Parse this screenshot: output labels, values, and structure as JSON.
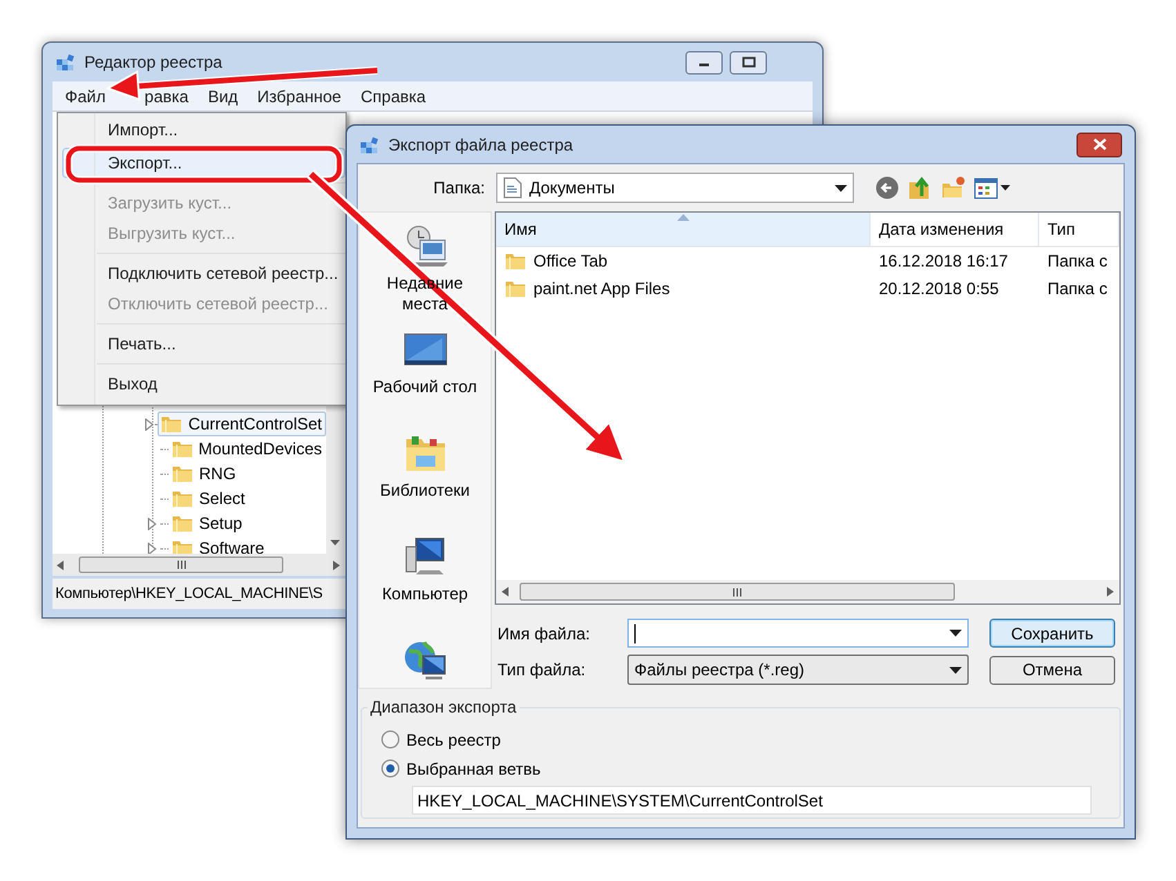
{
  "registry_window": {
    "title": "Редактор реестра",
    "menu": [
      "Файл",
      "равка",
      "Вид",
      "Избранное",
      "Справка"
    ],
    "file_menu": [
      {
        "kind": "item",
        "label": "Импорт...",
        "disabled": false,
        "selected": false
      },
      {
        "kind": "item",
        "label": "Экспорт...",
        "disabled": false,
        "selected": true
      },
      {
        "kind": "separator"
      },
      {
        "kind": "item",
        "label": "Загрузить куст...",
        "disabled": true,
        "selected": false
      },
      {
        "kind": "item",
        "label": "Выгрузить куст...",
        "disabled": true,
        "selected": false
      },
      {
        "kind": "separator"
      },
      {
        "kind": "item",
        "label": "Подключить сетевой реестр...",
        "disabled": false,
        "selected": false
      },
      {
        "kind": "item",
        "label": "Отключить сетевой реестр...",
        "disabled": true,
        "selected": false
      },
      {
        "kind": "separator"
      },
      {
        "kind": "item",
        "label": "Печать...",
        "disabled": false,
        "selected": false
      },
      {
        "kind": "separator"
      },
      {
        "kind": "item",
        "label": "Выход",
        "disabled": false,
        "selected": false
      }
    ],
    "tree": [
      {
        "label": "CurrentControlSet",
        "has_children": true,
        "selected": true
      },
      {
        "label": "MountedDevices",
        "has_children": false,
        "selected": false
      },
      {
        "label": "RNG",
        "has_children": false,
        "selected": false
      },
      {
        "label": "Select",
        "has_children": false,
        "selected": false
      },
      {
        "label": "Setup",
        "has_children": true,
        "selected": false
      },
      {
        "label": "Software",
        "has_children": true,
        "selected": false
      }
    ],
    "status_bar": "Компьютер\\HKEY_LOCAL_MACHINE\\S"
  },
  "export_dialog": {
    "title": "Экспорт файла реестра",
    "folder_label": "Папка:",
    "folder": "Документы",
    "places": [
      {
        "kind": "recent",
        "label": "Недавние места"
      },
      {
        "kind": "desktop",
        "label": "Рабочий стол"
      },
      {
        "kind": "libraries",
        "label": "Библиотеки"
      },
      {
        "kind": "computer",
        "label": "Компьютер"
      },
      {
        "kind": "network"
      }
    ],
    "columns": [
      {
        "label": "Имя",
        "sorted": true
      },
      {
        "label": "Дата изменения",
        "sorted": false
      },
      {
        "label": "Тип",
        "sorted": false
      }
    ],
    "rows": [
      [
        "Office Tab",
        "16.12.2018 16:17",
        "Папка с"
      ],
      [
        "paint.net App Files",
        "20.12.2018 0:55",
        "Папка с"
      ]
    ],
    "file_name_label": "Имя файла:",
    "file_type_label": "Тип файла:",
    "file_type": "Файлы реестра (*.reg)",
    "buttons": [
      {
        "label": "Сохранить",
        "default": true
      },
      {
        "label": "Отмена",
        "default": false
      }
    ],
    "range": {
      "title": "Диапазон экспорта",
      "options": [
        {
          "label": "Весь реестр",
          "selected": false
        },
        {
          "label": "Выбранная ветвь",
          "selected": true
        }
      ],
      "branch": "HKEY_LOCAL_MACHINE\\SYSTEM\\CurrentControlSet"
    }
  }
}
